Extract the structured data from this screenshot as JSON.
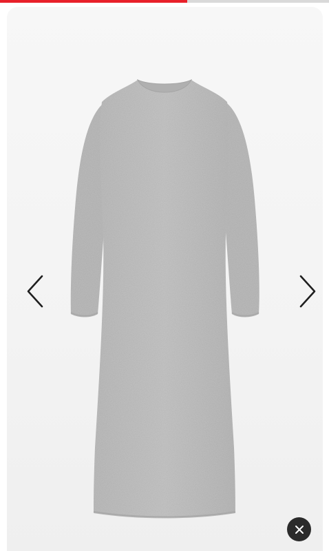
{
  "gallery": {
    "progress_fraction": 0.57,
    "progress_color": "#e8202a",
    "product_image": {
      "description_icon": "grey-knit-long-dress-image"
    },
    "prev_icon": "chevron-left-icon",
    "next_icon": "chevron-right-icon",
    "close_icon": "close-icon"
  }
}
